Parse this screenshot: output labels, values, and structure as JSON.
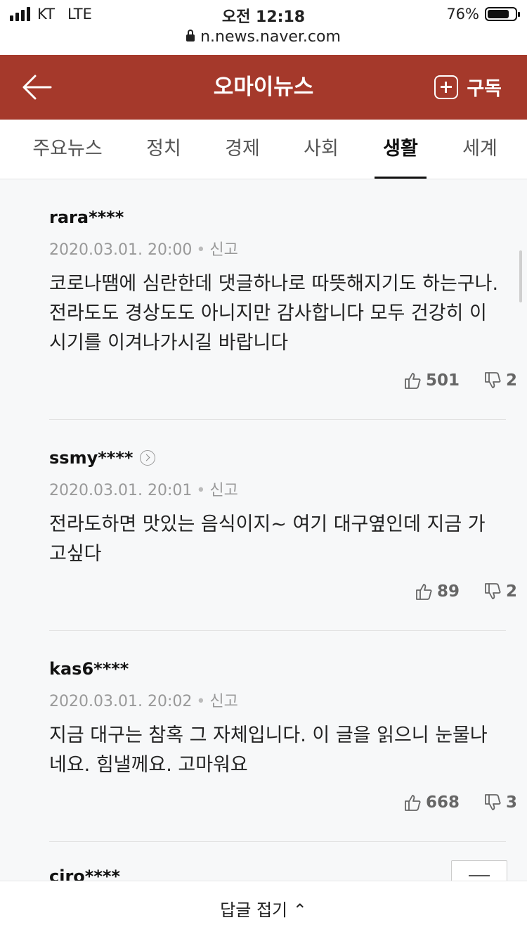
{
  "status_bar": {
    "carrier": "KT",
    "network": "LTE",
    "time": "오전 12:18",
    "battery": "76%",
    "url": "n.news.naver.com"
  },
  "header": {
    "title": "오마이뉴스",
    "subscribe_label": "구독",
    "color": "#a5392b"
  },
  "tabs": [
    {
      "label": "주요뉴스"
    },
    {
      "label": "정치"
    },
    {
      "label": "경제"
    },
    {
      "label": "사회"
    },
    {
      "label": "생활",
      "active": true
    },
    {
      "label": "세계"
    }
  ],
  "comments": [
    {
      "user": "rara****",
      "date": "2020.03.01. 20:00",
      "report": "신고",
      "text": "코로나땜에 심란한데 댓글하나로 따뜻해지기도 하는구나. 전라도도 경상도도 아니지만 감사합니다 모두 건강히 이 시기를 이겨나가시길 바랍니다",
      "likes": "501",
      "dislikes": "2"
    },
    {
      "user": "ssmy****",
      "date": "2020.03.01. 20:01",
      "report": "신고",
      "text": "전라도하면 맛있는 음식이지~ 여기 대구옆인데 지금 가고싶다",
      "likes": "89",
      "dislikes": "2"
    },
    {
      "user": "kas6****",
      "date": "2020.03.01. 20:02",
      "report": "신고",
      "text": "지금 대구는 참혹 그 자체입니다. 이 글을 읽으니 눈물나네요. 힘낼께요. 고마워요",
      "likes": "668",
      "dislikes": "3"
    }
  ],
  "partial_user": "ciro****",
  "bottom_bar": {
    "label": "답글 접기 ⌃"
  }
}
